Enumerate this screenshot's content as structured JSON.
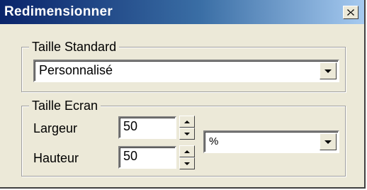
{
  "window": {
    "title": "Redimensionner"
  },
  "icons": {
    "close": "close-icon",
    "dropdown": "chevron-down-icon",
    "spin_up": "spin-up-icon",
    "spin_down": "spin-down-icon"
  },
  "colors": {
    "title_bar_start": "#0a246a",
    "title_bar_end": "#a6caf0",
    "dialog_background": "#ece9d8"
  },
  "standard_size": {
    "legend": "Taille Standard",
    "selected": "Personnalisé"
  },
  "screen_size": {
    "legend": "Taille Ecran",
    "width_label": "Largeur",
    "width_value": "50",
    "height_label": "Hauteur",
    "height_value": "50",
    "unit_selected": "%"
  }
}
